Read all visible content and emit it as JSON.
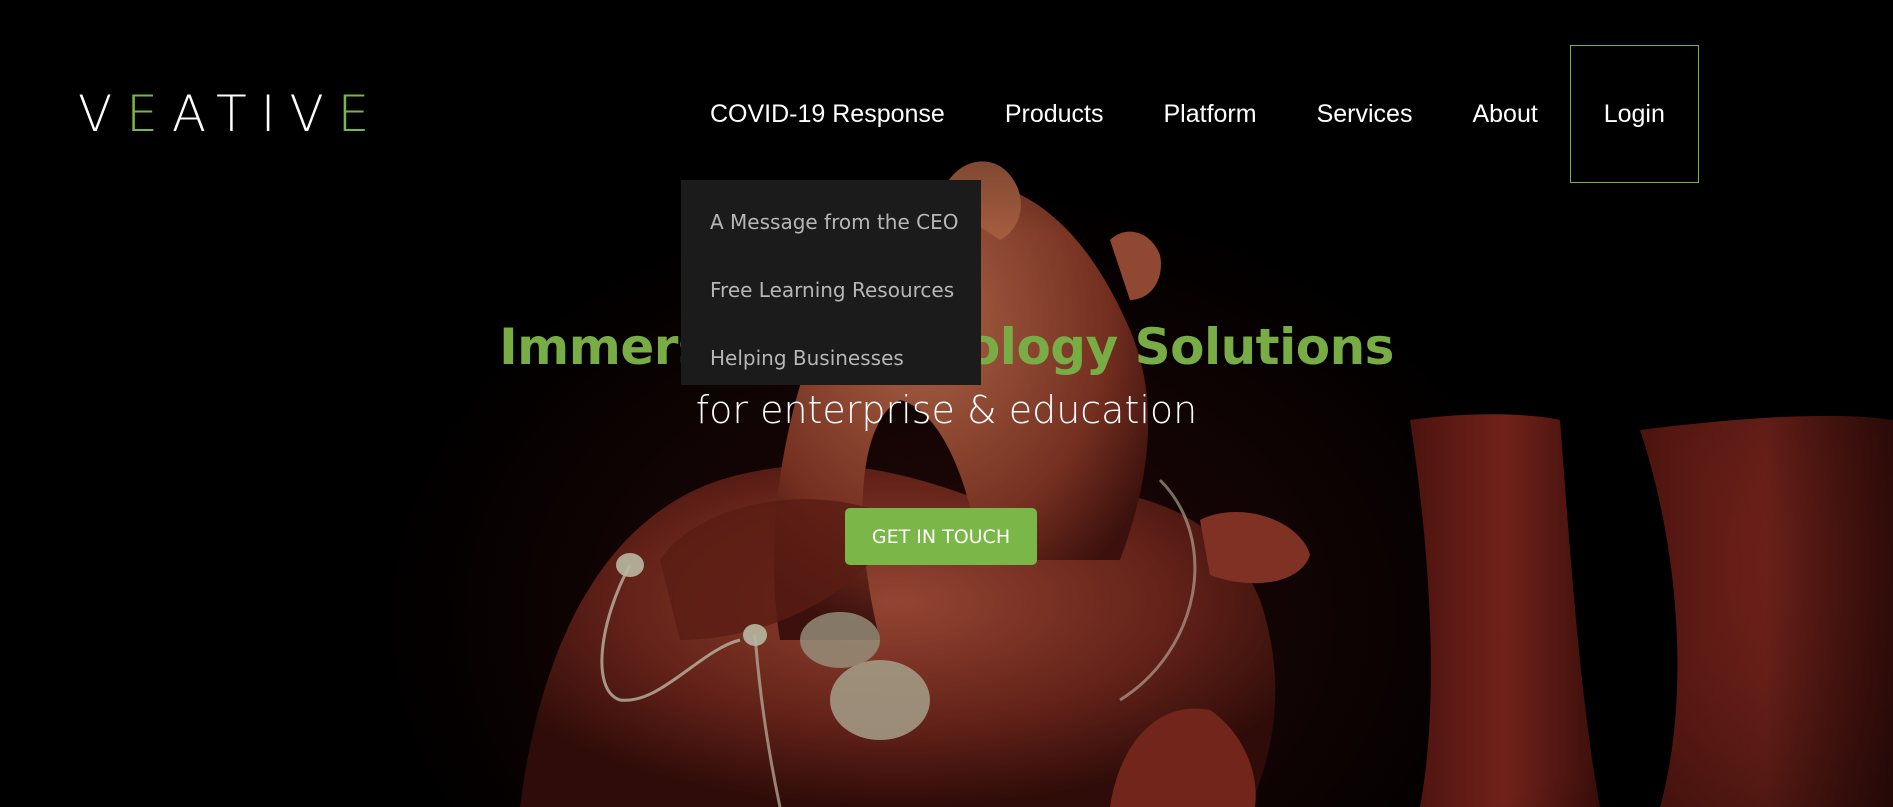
{
  "brand": {
    "logo_letters": [
      "V",
      "E",
      "A",
      "T",
      "I",
      "V",
      "E"
    ],
    "accent_color": "#7ab648"
  },
  "nav": {
    "items": [
      {
        "label": "COVID-19 Response"
      },
      {
        "label": "Products"
      },
      {
        "label": "Platform"
      },
      {
        "label": "Services"
      },
      {
        "label": "About"
      }
    ],
    "login_label": "Login"
  },
  "dropdown": {
    "items": [
      {
        "label": "A Message from the CEO"
      },
      {
        "label": "Free Learning Resources"
      },
      {
        "label": "Helping Businesses"
      }
    ]
  },
  "hero": {
    "headline": "Immersive Technology Solutions",
    "subheadline": "for enterprise & education",
    "cta_label": "GET IN TOUCH",
    "background": "anatomical heart illustration"
  }
}
